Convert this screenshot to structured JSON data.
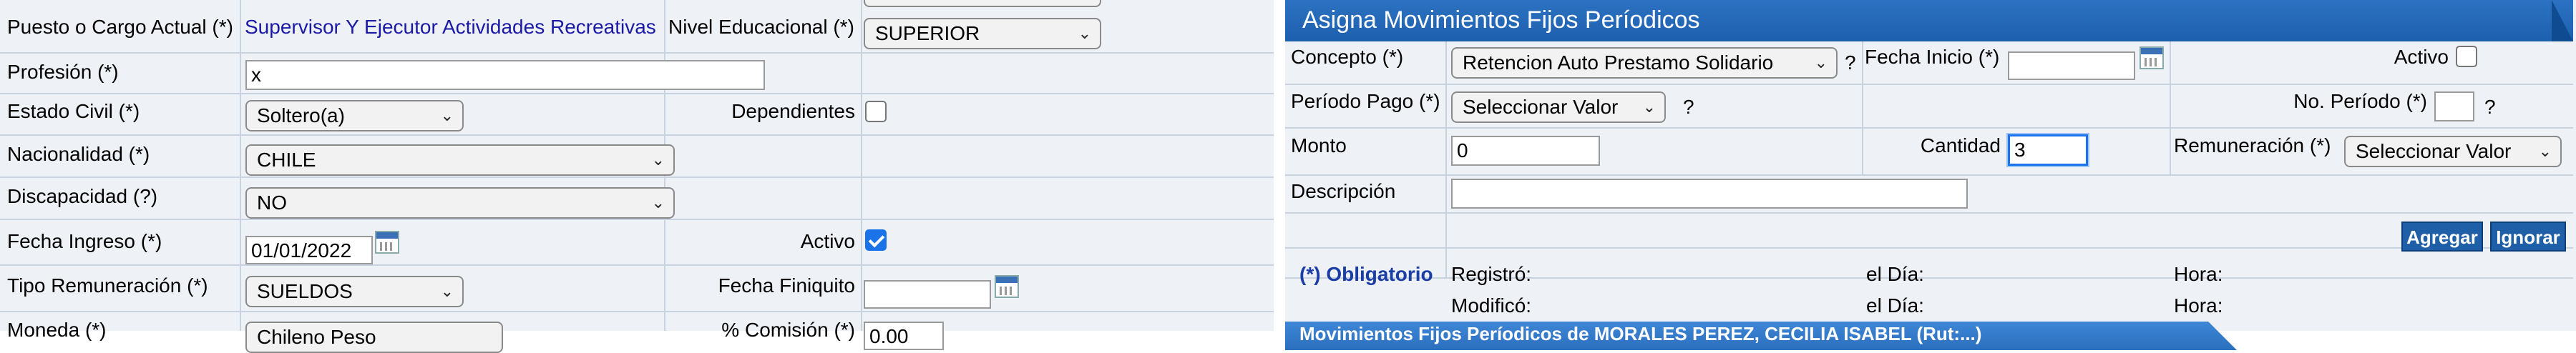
{
  "left": {
    "puesto_label": "Puesto o Cargo Actual (*)",
    "puesto_value": "Supervisor Y Ejecutor Actividades Recreativas",
    "nivel_label": "Nivel Educacional (*)",
    "nivel_value": "SUPERIOR",
    "profesion_label": "Profesión (*)",
    "profesion_value": "x",
    "estado_civil_label": "Estado Civil (*)",
    "estado_civil_value": "Soltero(a)",
    "dependientes_label": "Dependientes",
    "nacionalidad_label": "Nacionalidad (*)",
    "nacionalidad_value": "CHILE",
    "discapacidad_label": "Discapacidad (?)",
    "discapacidad_value": "NO",
    "fecha_ingreso_label": "Fecha Ingreso (*)",
    "fecha_ingreso_value": "01/01/2022",
    "activo_label": "Activo",
    "tipo_rem_label": "Tipo Remuneración (*)",
    "tipo_rem_value": "SUELDOS",
    "fecha_finiquito_label": "Fecha Finiquito",
    "moneda_label": "Moneda (*)",
    "moneda_value": "Chileno Peso",
    "comision_label": "% Comisión (*)",
    "comision_value": "0.00"
  },
  "right": {
    "title": "Asigna Movimientos Fijos Períodicos",
    "concepto_label": "Concepto (*)",
    "concepto_value": "Retencion Auto Prestamo Solidario",
    "q1": "?",
    "fecha_inicio_label": "Fecha Inicio (*)",
    "activo_label": "Activo",
    "periodo_label": "Período Pago (*)",
    "periodo_value": "Seleccionar Valor",
    "q2": "?",
    "no_periodo_label": "No. Período (*)",
    "q3": "?",
    "monto_label": "Monto",
    "monto_value": "0",
    "cantidad_label": "Cantidad",
    "cantidad_value": "3",
    "remuneracion_label": "Remuneración (*)",
    "remuneracion_value": "Seleccionar Valor",
    "descripcion_label": "Descripción",
    "agregar": "Agregar",
    "ignorar": "Ignorar",
    "obligatorio": "(*) Obligatorio",
    "registro_label": "Registró:",
    "el_dia_1": "el Día:",
    "hora_1": "Hora:",
    "modifico_label": "Modificó:",
    "el_dia_2": "el Día:",
    "hora_2": "Hora:",
    "bottom_tab": "Movimientos Fijos Períodicos de MORALES PEREZ, CECILIA ISABEL (Rut:...)"
  },
  "colors": {
    "header_blue": "#1c5fae",
    "panel_bg": "#eef2f6",
    "link_blue": "#1a1aa6",
    "checkbox_blue": "#1a73e8"
  }
}
